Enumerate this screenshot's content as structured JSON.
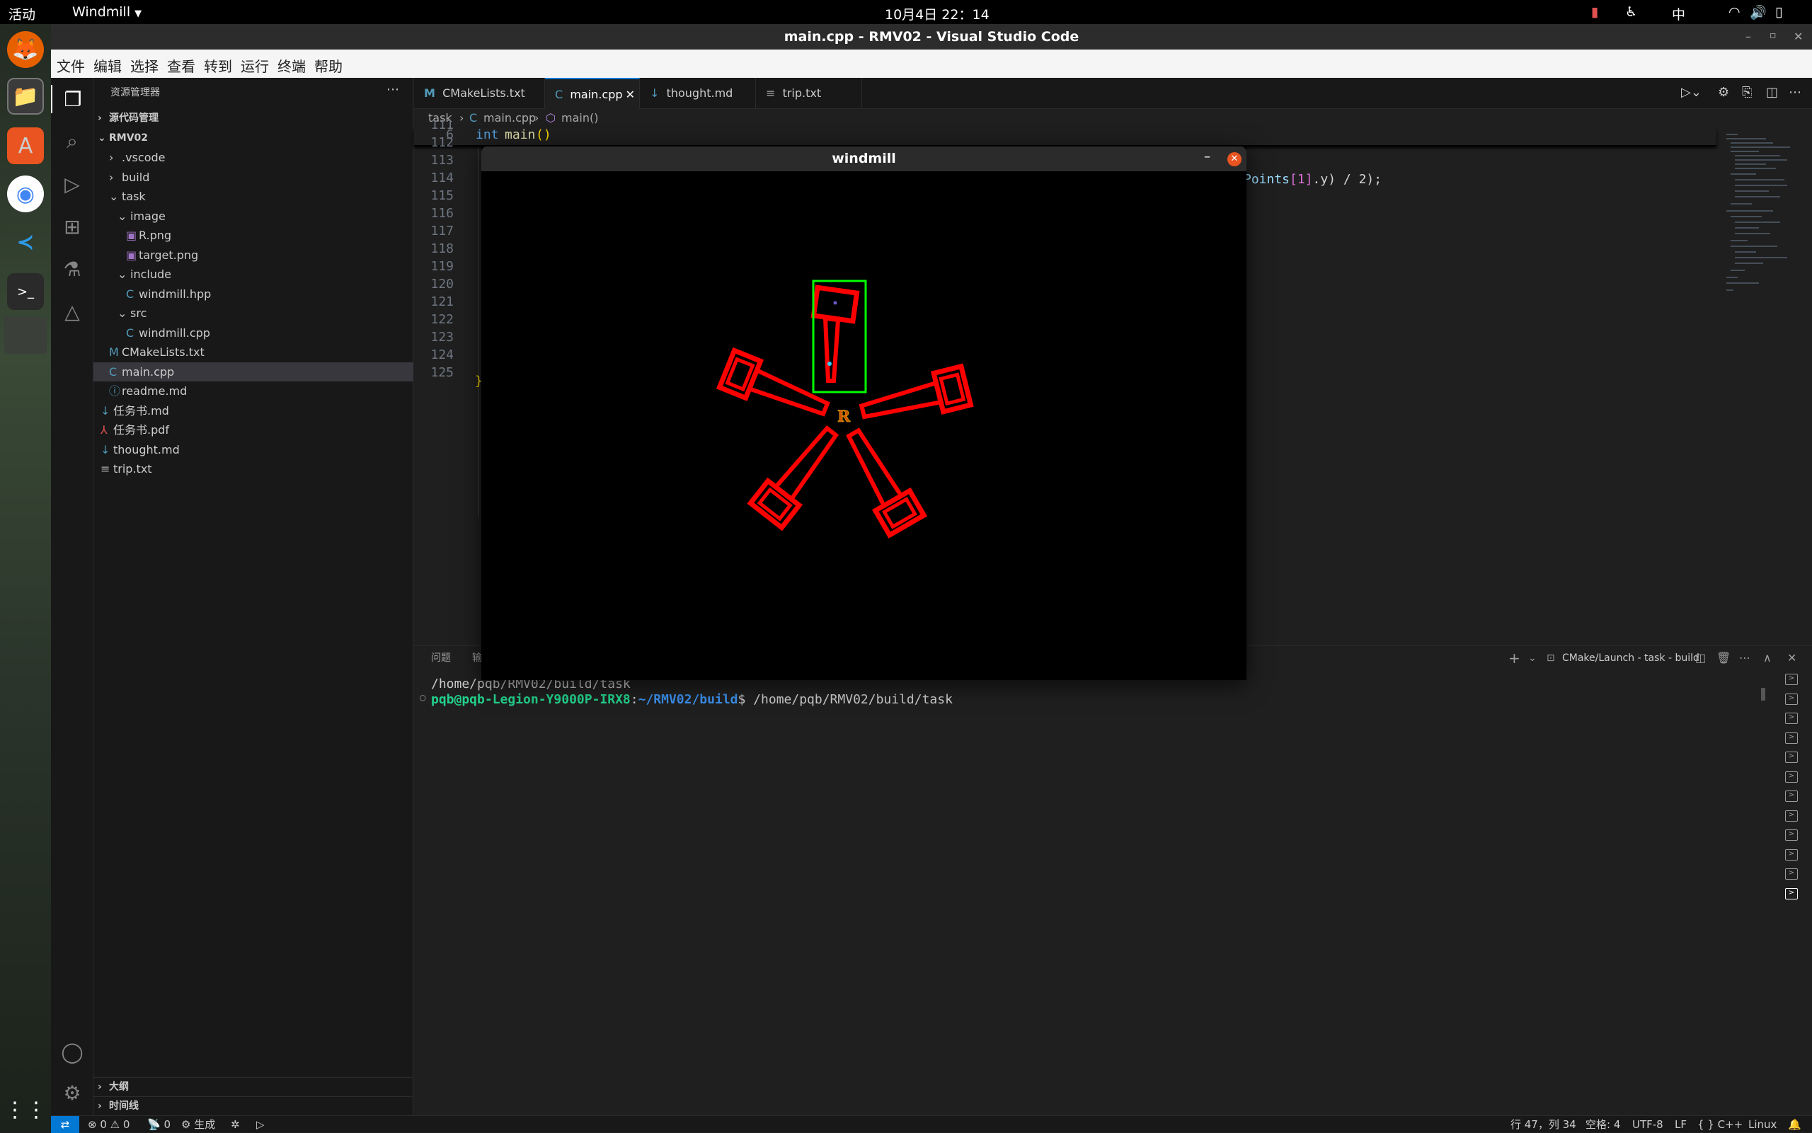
{
  "topbar": {
    "activities": "活动",
    "app": "Windmill",
    "clock": "10月4日  22：14",
    "input_method": "中"
  },
  "window": {
    "title": "main.cpp - RMV02 - Visual Studio Code"
  },
  "menu": [
    "文件",
    "编辑",
    "选择",
    "查看",
    "转到",
    "运行",
    "终端",
    "帮助"
  ],
  "explorer": {
    "header": "资源管理器",
    "scm": "源代码管理",
    "root": "RMV02",
    "items": [
      {
        "label": ".vscode",
        "kind": "folder-closed"
      },
      {
        "label": "build",
        "kind": "folder-closed"
      },
      {
        "label": "task",
        "kind": "folder-open"
      },
      {
        "label": "image",
        "kind": "folder-open"
      },
      {
        "label": "R.png",
        "kind": "image"
      },
      {
        "label": "target.png",
        "kind": "image"
      },
      {
        "label": "include",
        "kind": "folder-open"
      },
      {
        "label": "windmill.hpp",
        "kind": "cpp"
      },
      {
        "label": "src",
        "kind": "folder-open"
      },
      {
        "label": "windmill.cpp",
        "kind": "cpp"
      },
      {
        "label": "CMakeLists.txt",
        "kind": "cmake"
      },
      {
        "label": "main.cpp",
        "kind": "cpp"
      },
      {
        "label": "readme.md",
        "kind": "info"
      },
      {
        "label": "任务书.md",
        "kind": "md"
      },
      {
        "label": "任务书.pdf",
        "kind": "pdf"
      },
      {
        "label": "thought.md",
        "kind": "md"
      },
      {
        "label": "trip.txt",
        "kind": "txt"
      }
    ],
    "outline": "大纲",
    "timeline": "时间线"
  },
  "tabs": [
    {
      "label": "CMakeLists.txt",
      "icon": "M"
    },
    {
      "label": "main.cpp",
      "icon": "C"
    },
    {
      "label": "thought.md",
      "icon": "↓"
    },
    {
      "label": "trip.txt",
      "icon": "≡"
    }
  ],
  "breadcrumb": {
    "folder": "task",
    "file": "main.cpp",
    "symbol": "main()"
  },
  "editor": {
    "sticky_line_no": "6",
    "sticky_kw": "int",
    "sticky_fn": "main",
    "sticky_paren": "()",
    "line_numbers": [
      "111",
      "112",
      "113",
      "114",
      "115",
      "116",
      "117",
      "118",
      "119",
      "120",
      "121",
      "122",
      "123",
      "124",
      "125"
    ],
    "line113_tail_a": "Points",
    "line113_tail_b": "[1]",
    "line113_tail_c": ".y) / 2);",
    "line125": "}"
  },
  "popup": {
    "title": "windmill",
    "minimize": "–",
    "center_label": "R"
  },
  "panel": {
    "tab_problems": "问题",
    "tab_output": "输",
    "terminal_name": "CMake/Launch - task - build"
  },
  "terminal": {
    "line1": "/home/pqb/RMV02/build/task",
    "user": "pqb@pqb-Legion-Y9000P-IRX8",
    "colon": ":",
    "path": "~/RMV02/build",
    "prompt": "$ ",
    "command": "/home/pqb/RMV02/build/task"
  },
  "status": {
    "errors": "0",
    "warnings": "0",
    "ports": "0",
    "build": "生成",
    "position": "行 47，列 34",
    "spaces": "空格: 4",
    "encoding": "UTF-8",
    "eol": "LF",
    "language": "C++",
    "os": "Linux"
  },
  "colors": {
    "accent": "#0078d4",
    "keyword": "#569cd6",
    "function": "#dcdcaa",
    "red_blade": "#ff0000",
    "bbox_green": "#00ff00"
  }
}
